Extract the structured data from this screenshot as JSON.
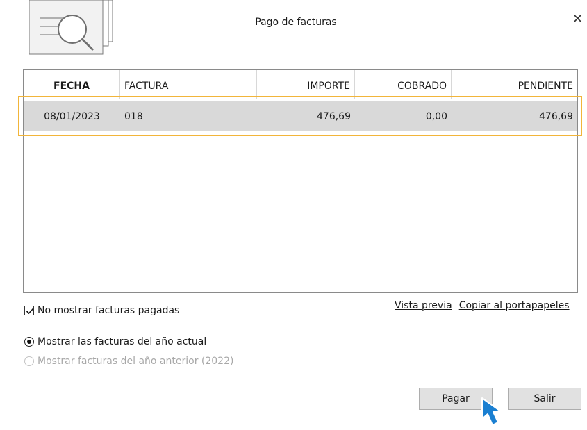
{
  "dialog": {
    "title": "Pago de facturas",
    "close_symbol": "✕"
  },
  "table": {
    "headers": {
      "fecha": "FECHA",
      "factura": "FACTURA",
      "importe": "IMPORTE",
      "cobrado": "COBRADO",
      "pendiente": "PENDIENTE"
    },
    "rows": [
      {
        "fecha": "08/01/2023",
        "factura": "018",
        "importe": "476,69",
        "cobrado": "0,00",
        "pendiente": "476,69"
      }
    ]
  },
  "options": {
    "hide_paid_label": "No mostrar facturas pagadas",
    "hide_paid_checked": true,
    "radio_current_label": "Mostrar las facturas del año actual",
    "radio_previous_label": "Mostrar facturas del año anterior (2022)"
  },
  "links": {
    "preview": "Vista previa",
    "copy": "Copiar al portapapeles"
  },
  "buttons": {
    "pay": "Pagar",
    "exit": "Salir"
  },
  "colors": {
    "highlight": "#f2b53a",
    "selected_row": "#d9d9d9",
    "cursor": "#1a7fd1"
  },
  "icons": {
    "header": "document-search-icon",
    "cursor": "mouse-pointer-icon"
  }
}
